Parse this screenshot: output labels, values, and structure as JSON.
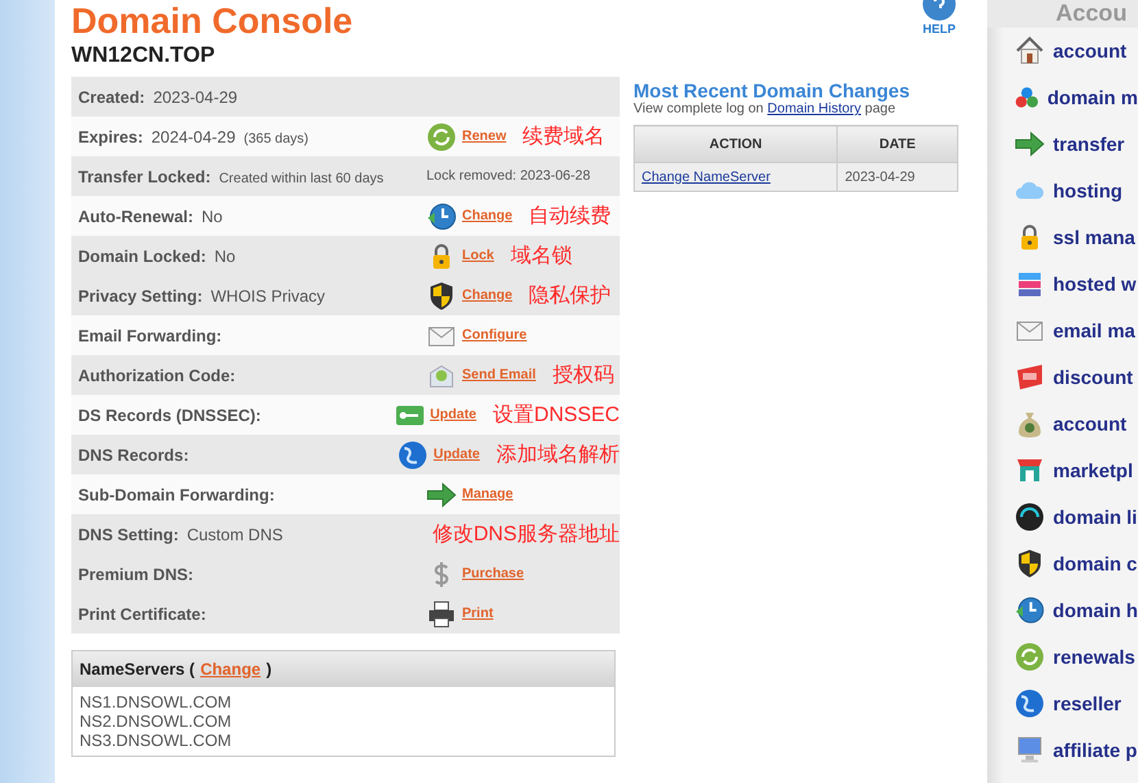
{
  "page": {
    "title": "Domain Console",
    "help": "HELP"
  },
  "domain": "WN12CN.TOP",
  "details": [
    {
      "label": "Created:",
      "value": "2023-04-29",
      "shaded": true
    },
    {
      "label": "Expires:",
      "value": "2024-04-29",
      "detail": "(365 days)",
      "shaded": false,
      "action": {
        "kind": "renew",
        "link": "Renew"
      },
      "note": "续费域名"
    },
    {
      "label": "Transfer Locked:",
      "detail": "Created within last 60 days",
      "shaded": true,
      "info": "Lock removed: 2023-06-28"
    },
    {
      "label": "Auto-Renewal:",
      "value": "No",
      "shaded": false,
      "action": {
        "kind": "clock",
        "link": "Change"
      },
      "note": "自动续费"
    },
    {
      "label": "Domain Locked:",
      "value": "No",
      "shaded": true,
      "action": {
        "kind": "lock",
        "link": "Lock"
      },
      "note": "域名锁"
    },
    {
      "label": "Privacy Setting:",
      "value": "WHOIS Privacy",
      "shaded": true,
      "action": {
        "kind": "shield",
        "link": "Change"
      },
      "note": "隐私保护"
    },
    {
      "label": "Email Forwarding:",
      "shaded": false,
      "action": {
        "kind": "envelope",
        "link": "Configure"
      }
    },
    {
      "label": "Authorization Code:",
      "shaded": true,
      "action": {
        "kind": "mail",
        "link": "Send Email"
      },
      "note": "授权码"
    },
    {
      "label": "DS Records (DNSSEC):",
      "shaded": false,
      "action": {
        "kind": "key",
        "link": "Update"
      },
      "note": "设置DNSSEC"
    },
    {
      "label": "DNS Records:",
      "shaded": true,
      "action": {
        "kind": "globe",
        "link": "Update"
      },
      "note": "添加域名解析"
    },
    {
      "label": "Sub-Domain Forwarding:",
      "shaded": false,
      "action": {
        "kind": "arrow",
        "link": "Manage"
      }
    },
    {
      "label": "DNS Setting:",
      "value": "Custom DNS",
      "shaded": true,
      "note": "修改DNS服务器地址"
    },
    {
      "label": "Premium DNS:",
      "shaded": true,
      "action": {
        "kind": "dollar",
        "link": "Purchase"
      }
    },
    {
      "label": "Print Certificate:",
      "shaded": true,
      "action": {
        "kind": "printer",
        "link": "Print"
      }
    }
  ],
  "changes": {
    "title": "Most Recent Domain Changes",
    "log_before": "View complete log on",
    "log_link": "Domain History",
    "log_after": "page",
    "columns": [
      "ACTION",
      "DATE"
    ],
    "rows": [
      {
        "action": "Change NameServer",
        "date": "2023-04-29"
      }
    ]
  },
  "nameservers": {
    "title": "NameServers (",
    "link": "Change",
    "title_end": ")",
    "items": [
      "NS1.DNSOWL.COM",
      "NS2.DNSOWL.COM",
      "NS3.DNSOWL.COM"
    ]
  },
  "sidebar": {
    "title": "Accou",
    "items": [
      {
        "kind": "home",
        "label": "account"
      },
      {
        "kind": "cubes",
        "label": "domain m"
      },
      {
        "kind": "arrow",
        "label": "transfer"
      },
      {
        "kind": "cloud",
        "label": "hosting"
      },
      {
        "kind": "lock",
        "label": "ssl mana"
      },
      {
        "kind": "stack",
        "label": "hosted w"
      },
      {
        "kind": "envelope",
        "label": "email ma"
      },
      {
        "kind": "tag",
        "label": "discount"
      },
      {
        "kind": "moneybag",
        "label": "account"
      },
      {
        "kind": "store",
        "label": "marketpl"
      },
      {
        "kind": "dial",
        "label": "domain li"
      },
      {
        "kind": "shield",
        "label": "domain c"
      },
      {
        "kind": "clock",
        "label": "domain h"
      },
      {
        "kind": "renew",
        "label": "renewals"
      },
      {
        "kind": "globe",
        "label": "reseller"
      },
      {
        "kind": "monitor",
        "label": "affiliate p"
      }
    ]
  }
}
